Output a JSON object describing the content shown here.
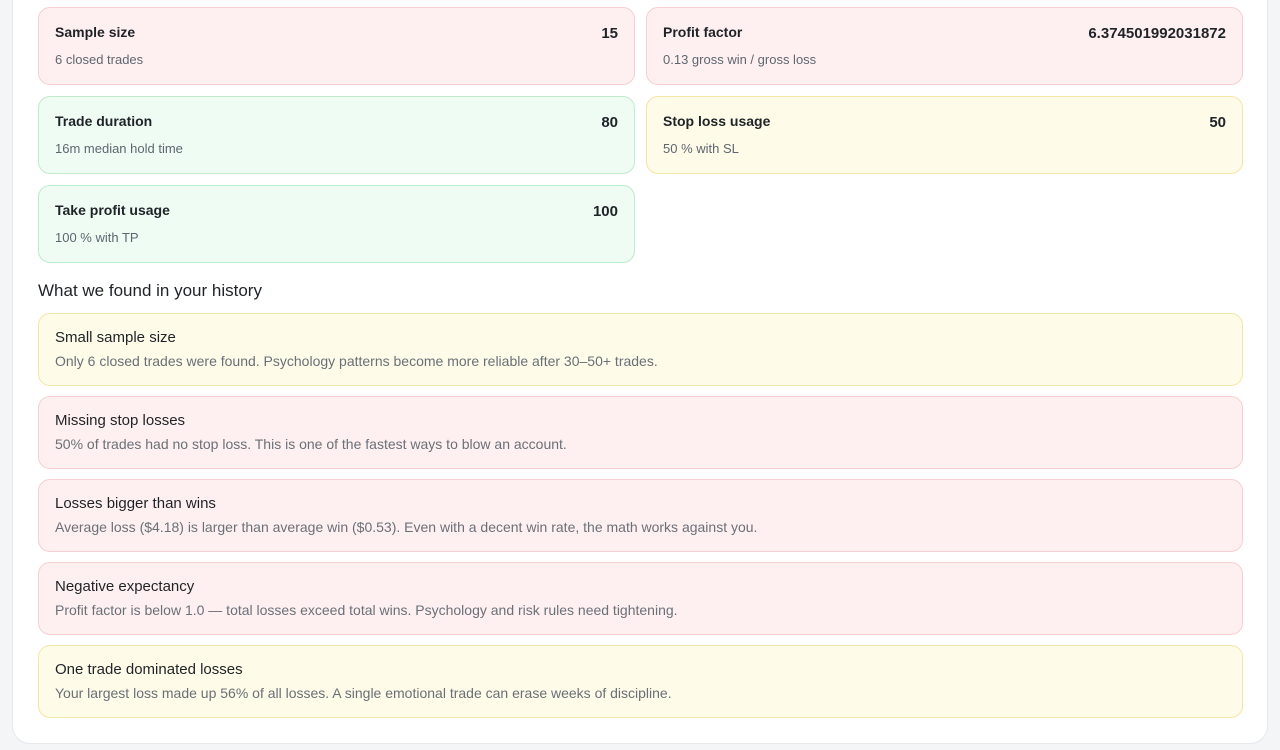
{
  "metrics": [
    {
      "title": "Sample size",
      "value": "15",
      "subtitle": "6 closed trades",
      "tone": "red"
    },
    {
      "title": "Profit factor",
      "value": "6.374501992031872",
      "subtitle": "0.13 gross win / gross loss",
      "tone": "red"
    },
    {
      "title": "Trade duration",
      "value": "80",
      "subtitle": "16m median hold time",
      "tone": "green"
    },
    {
      "title": "Stop loss usage",
      "value": "50",
      "subtitle": "50 % with SL",
      "tone": "yellow"
    },
    {
      "title": "Take profit usage",
      "value": "100",
      "subtitle": "100 % with TP",
      "tone": "green"
    }
  ],
  "history": {
    "heading": "What we found in your history",
    "findings": [
      {
        "title": "Small sample size",
        "description": "Only 6 closed trades were found. Psychology patterns become more reliable after 30–50+ trades.",
        "tone": "yellow"
      },
      {
        "title": "Missing stop losses",
        "description": "50% of trades had no stop loss. This is one of the fastest ways to blow an account.",
        "tone": "red"
      },
      {
        "title": "Losses bigger than wins",
        "description": "Average loss ($4.18) is larger than average win ($0.53). Even with a decent win rate, the math works against you.",
        "tone": "red"
      },
      {
        "title": "Negative expectancy",
        "description": "Profit factor is below 1.0 — total losses exceed total wins. Psychology and risk rules need tightening.",
        "tone": "red"
      },
      {
        "title": "One trade dominated losses",
        "description": "Your largest loss made up 56% of all losses. A single emotional trade can erase weeks of discipline.",
        "tone": "yellow"
      }
    ]
  },
  "colors": {
    "red_bg": "#fef0f0",
    "green_bg": "#eefcf3",
    "yellow_bg": "#fefbe8"
  }
}
